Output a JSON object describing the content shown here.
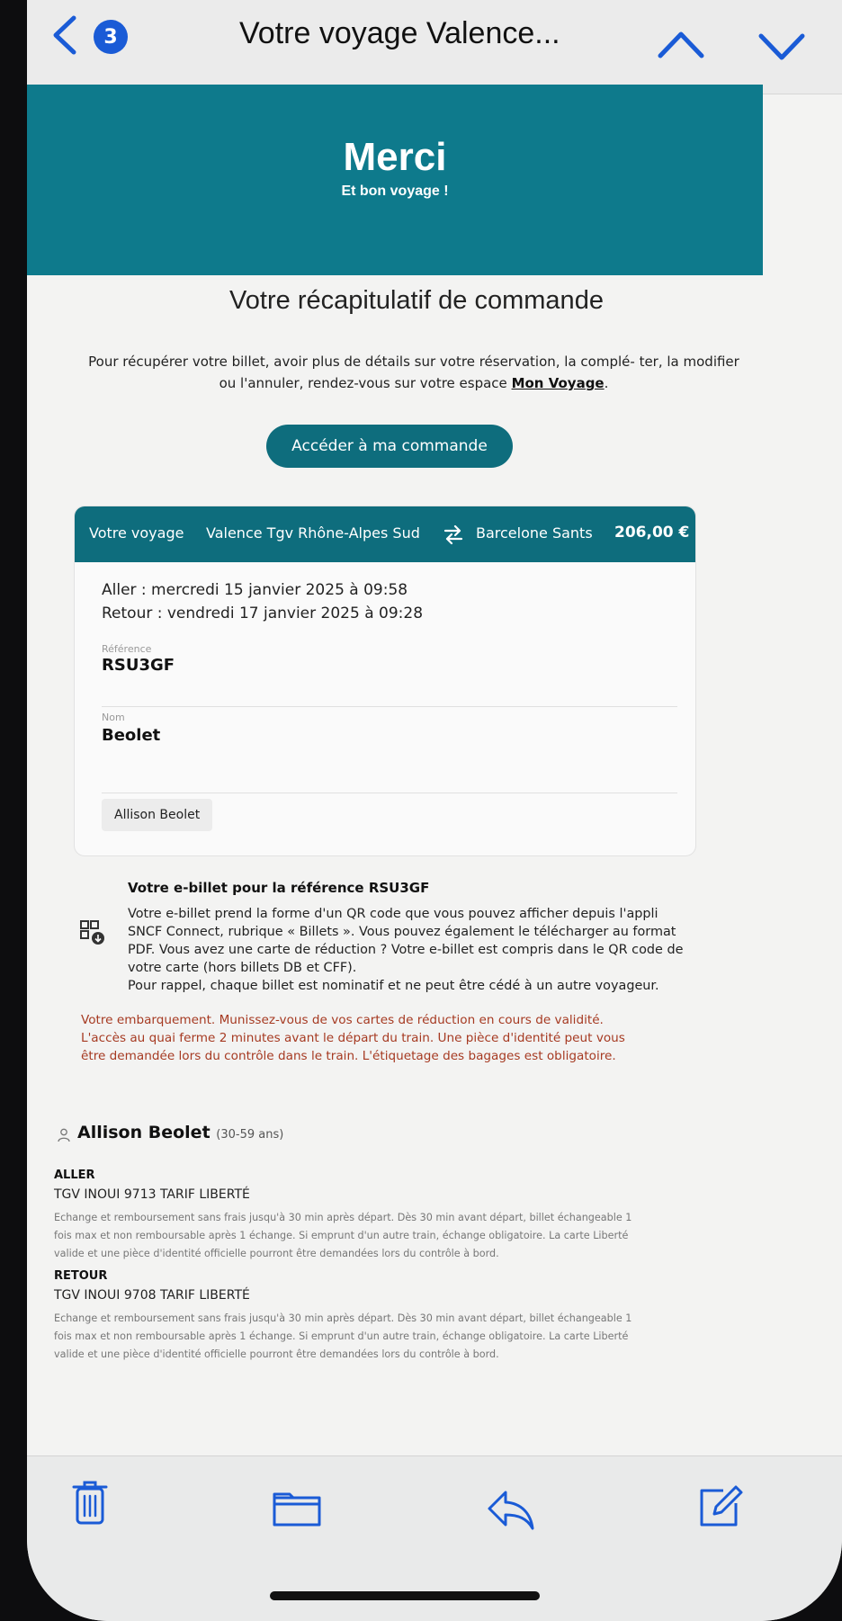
{
  "nav": {
    "back_icon": "chevron-left-icon",
    "unread_count": "3",
    "title": "Votre voyage Valence...",
    "prev_icon": "chevron-up-icon",
    "next_icon": "chevron-down-icon"
  },
  "colors": {
    "brand": "#0e7a8c",
    "button": "#0e6d7d",
    "warning": "#a63a22",
    "badge": "#1a5bd6"
  },
  "hero": {
    "title": "Merci",
    "subtitle": "Et bon voyage !"
  },
  "summary_title": "Votre récapitulatif de commande",
  "intro": {
    "text": "Pour récupérer votre billet, avoir plus de détails sur votre réservation, la complé- ter, la modifier ou l'annuler, rendez-vous sur votre espace",
    "link": "Mon Voyage",
    "end": "."
  },
  "cta_label": "Accéder à ma commande",
  "trip": {
    "label": "Votre voyage",
    "origin": "Valence Tgv Rhône-Alpes Sud",
    "swap_icon": "round-trip-arrows-icon",
    "destination": "Barcelone Sants",
    "price": "206,00 €",
    "outbound": "Aller : mercredi 15 janvier 2025 à 09:58",
    "return": "Retour : vendredi 17 janvier 2025 à 09:28",
    "reference_label": "Référence",
    "reference": "RSU3GF",
    "name_label": "Nom",
    "name": "Beolet",
    "passenger_chip": "Allison Beolet"
  },
  "ebillet": {
    "icon": "qr-code-download-icon",
    "title": "Votre e-billet pour la référence RSU3GF",
    "lines": [
      "Votre e-billet prend la forme d'un QR code que vous pouvez afficher depuis l'appli",
      "SNCF Connect, rubrique « Billets ». Vous pouvez également le télécharger au format",
      "PDF. Vous avez une carte de réduction ? Votre e-billet est compris dans le QR code de",
      "votre carte (hors billets DB et CFF).",
      "Pour rappel, chaque billet est nominatif et ne peut être cédé à un autre voyageur."
    ]
  },
  "warning_lines": [
    "Votre embarquement. Munissez-vous de vos cartes de réduction en cours de validité.",
    "L'accès au quai ferme 2 minutes avant le départ du train. Une pièce d'identité peut vous",
    "être demandée lors du contrôle dans le train. L'étiquetage des bagages est obligatoire."
  ],
  "passenger": {
    "icon": "person-icon",
    "name": "Allison Beolet",
    "age": "(30-59 ans)",
    "legs": [
      {
        "label": "ALLER",
        "train": "TGV INOUI 9713   TARIF LIBERTÉ",
        "conditions": [
          "Echange et remboursement sans frais jusqu'à 30 min après départ. Dès 30 min avant départ, billet échangeable 1",
          "fois max et non remboursable après 1 échange. Si emprunt d'un autre train, échange obligatoire. La carte Liberté",
          "valide et une pièce d'identité officielle pourront être demandées lors du contrôle à bord."
        ]
      },
      {
        "label": "RETOUR",
        "train": "TGV INOUI 9708   TARIF LIBERTÉ",
        "conditions": [
          "Echange et remboursement sans frais jusqu'à 30 min après départ. Dès 30 min avant départ, billet échangeable 1",
          "fois max et non remboursable après 1 échange. Si emprunt d'un autre train, échange obligatoire. La carte Liberté",
          "valide et une pièce d'identité officielle pourront être demandées lors du contrôle à bord."
        ]
      }
    ]
  },
  "toolbar": {
    "trash_icon": "trash-icon",
    "folder_icon": "folder-icon",
    "reply_icon": "reply-icon",
    "compose_icon": "compose-icon"
  }
}
